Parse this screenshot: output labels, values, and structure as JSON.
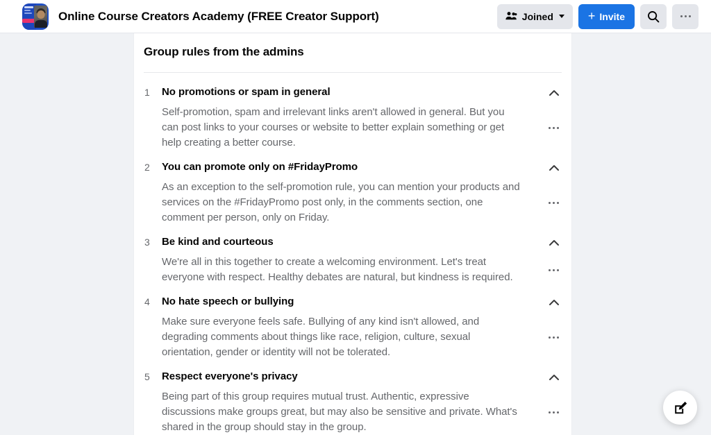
{
  "header": {
    "group_name": "Online Course Creators Academy (FREE Creator Support)",
    "avatar_icon": "group-cover-photo",
    "joined_button": {
      "label": "Joined",
      "icon": "people-group-icon",
      "chevron_icon": "chevron-down-icon"
    },
    "invite_button": {
      "label": "Invite",
      "plus": "+"
    },
    "search_button": {
      "icon": "search-icon"
    },
    "more_button": {
      "icon": "ellipsis-horizontal-icon"
    }
  },
  "main": {
    "section_title": "Group rules from the admins",
    "rules": [
      {
        "number": "1",
        "title": "No promotions or spam in general",
        "description": "Self-promotion, spam and irrelevant links aren't allowed in general. But you can post links to your courses or website to better explain something or get help creating a better course.",
        "collapse_icon": "chevron-up-icon",
        "more_icon": "ellipsis-horizontal-icon"
      },
      {
        "number": "2",
        "title": "You can promote only on #FridayPromo",
        "description": "As an exception to the self-promotion rule, you can mention your products and services on the #FridayPromo post only, in the comments section, one comment per person, only on Friday.",
        "collapse_icon": "chevron-up-icon",
        "more_icon": "ellipsis-horizontal-icon"
      },
      {
        "number": "3",
        "title": "Be kind and courteous",
        "description": "We're all in this together to create a welcoming environment. Let's treat everyone with respect. Healthy debates are natural, but kindness is required.",
        "collapse_icon": "chevron-up-icon",
        "more_icon": "ellipsis-horizontal-icon"
      },
      {
        "number": "4",
        "title": "No hate speech or bullying",
        "description": "Make sure everyone feels safe. Bullying of any kind isn't allowed, and degrading comments about things like race, religion, culture, sexual orientation, gender or identity will not be tolerated.",
        "collapse_icon": "chevron-up-icon",
        "more_icon": "ellipsis-horizontal-icon"
      },
      {
        "number": "5",
        "title": "Respect everyone's privacy",
        "description": "Being part of this group requires mutual trust. Authentic, expressive discussions make groups great, but may also be sensitive and private. What's shared in the group should stay in the group.",
        "collapse_icon": "chevron-up-icon",
        "more_icon": "ellipsis-horizontal-icon"
      }
    ]
  },
  "fab": {
    "icon": "compose-edit-icon"
  },
  "colors": {
    "accent_blue": "#1b74e4",
    "page_background": "#f0f2f5",
    "card_background": "#ffffff",
    "primary_text": "#050505",
    "secondary_text": "#65676b",
    "button_secondary": "#e4e6eb"
  }
}
